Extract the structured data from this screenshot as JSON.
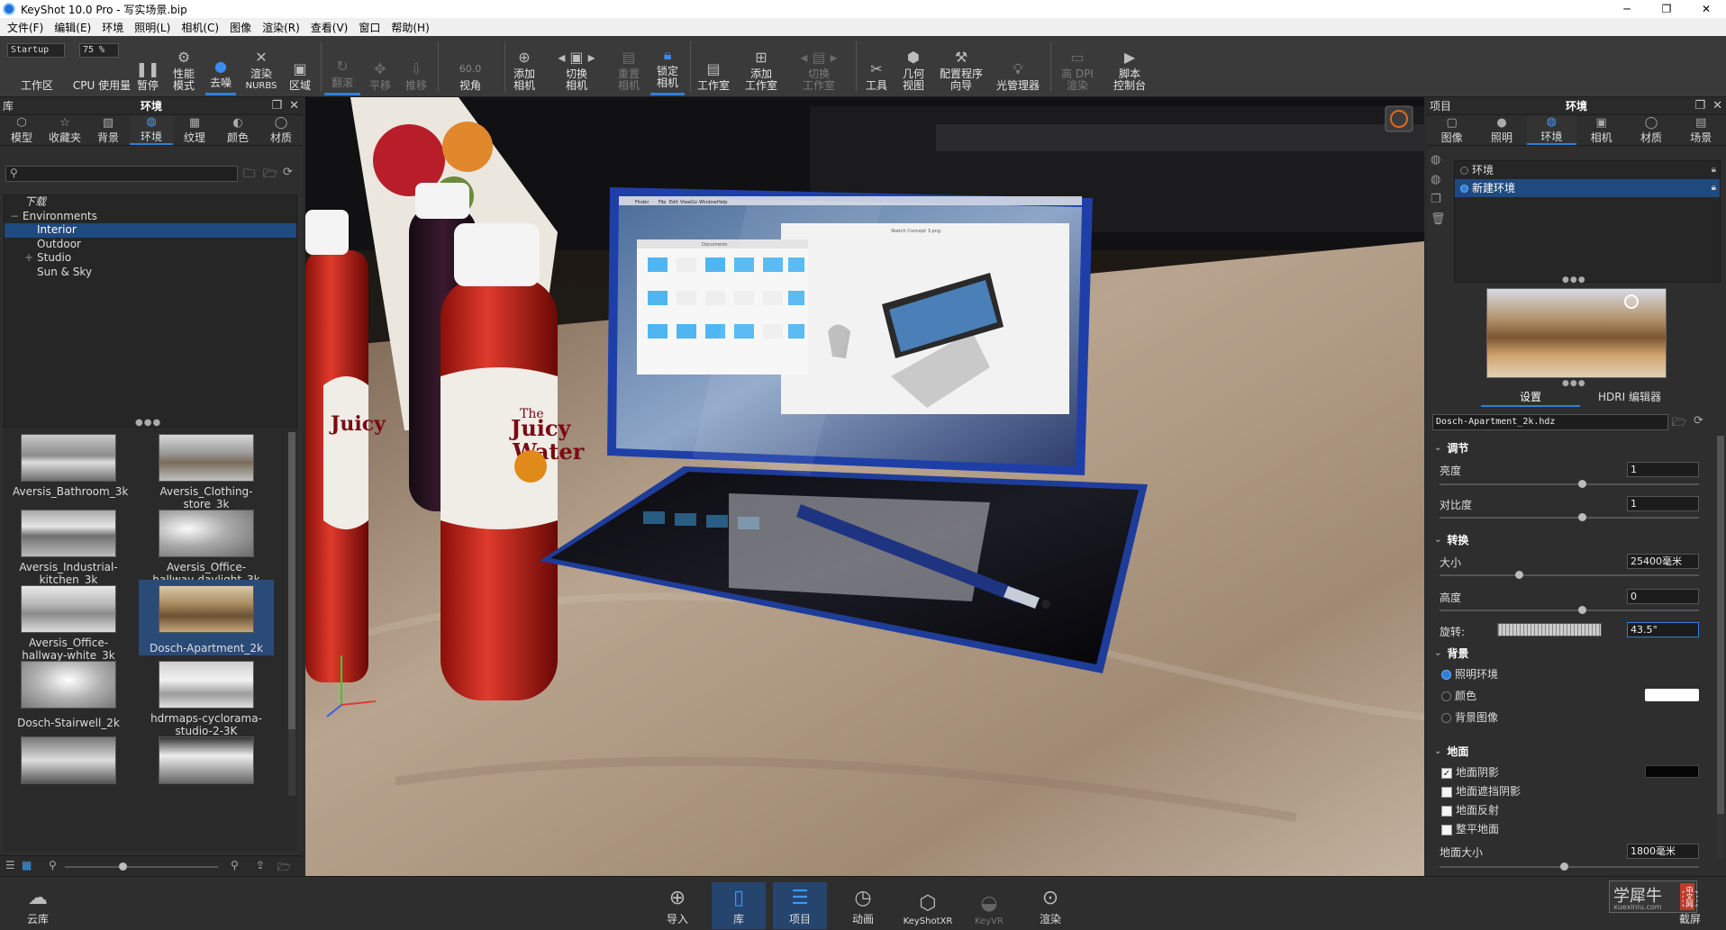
{
  "titlebar": {
    "title": "KeyShot 10.0 Pro  - 写实场景.bip",
    "minimize": "─",
    "maximize": "❐",
    "close": "✕"
  },
  "menu": [
    "文件(F)",
    "编辑(E)",
    "环境",
    "照明(L)",
    "相机(C)",
    "图像",
    "渲染(R)",
    "查看(V)",
    "窗口",
    "帮助(H)"
  ],
  "toolbar": {
    "workspace_value": "Startup",
    "workspace_label": "工作区",
    "cpu_value": "75 %",
    "cpu_label": "CPU 使用量",
    "pause_label": "暂停",
    "perf_label_1": "性能",
    "perf_label_2": "模式",
    "denoise_label": "去噪",
    "nurbs_label_1": "渲染",
    "nurbs_label_2": "NURBS",
    "region_label": "区域",
    "flip_label": "翻滚",
    "pan_label": "平移",
    "push_label": "推移",
    "fov_value": "60.0",
    "fov_label": "视角",
    "add_camera_1": "添加",
    "add_camera_2": "相机",
    "switch_camera_1": "切换",
    "switch_camera_2": "相机",
    "reset_camera_1": "重置",
    "reset_camera_2": "相机",
    "lock_camera_1": "锁定",
    "lock_camera_2": "相机",
    "studio_label": "工作室",
    "add_studio_1": "添加",
    "add_studio_2": "工作室",
    "switch_studio_1": "切换",
    "switch_studio_2": "工作室",
    "tools_label": "工具",
    "geometry_1": "几何",
    "geometry_2": "视图",
    "config_1": "配置程序",
    "config_2": "向导",
    "light_manager": "光管理器",
    "hidpi_1": "高 DPI",
    "hidpi_2": "渲染",
    "script_1": "脚本",
    "script_2": "控制台"
  },
  "library": {
    "title": "库",
    "panel_title": "环境",
    "tabs": [
      {
        "label": "模型",
        "icon": "model-icon"
      },
      {
        "label": "收藏夹",
        "icon": "star-icon"
      },
      {
        "label": "背景",
        "icon": "background-icon"
      },
      {
        "label": "环境",
        "icon": "globe-icon"
      },
      {
        "label": "纹理",
        "icon": "texture-icon"
      },
      {
        "label": "颜色",
        "icon": "palette-icon"
      },
      {
        "label": "材质",
        "icon": "material-icon"
      }
    ],
    "search_placeholder": "",
    "tree": [
      {
        "label": "下载",
        "indent": 0
      },
      {
        "label": "Environments",
        "indent": 0
      },
      {
        "label": "Interior",
        "indent": 2
      },
      {
        "label": "Outdoor",
        "indent": 2
      },
      {
        "label": "Studio",
        "indent": 2
      },
      {
        "label": "Sun & Sky",
        "indent": 2
      }
    ],
    "thumbnails": [
      {
        "label": "Aversis_Bathroom_3k"
      },
      {
        "label": "Aversis_Clothing-store_3k"
      },
      {
        "label": "Aversis_Industrial-kitchen_3k"
      },
      {
        "label": "Aversis_Office-hallway-daylight_3k"
      },
      {
        "label": "Aversis_Office-hallway-white_3k"
      },
      {
        "label": "Dosch-Apartment_2k"
      },
      {
        "label": "Dosch-Stairwell_2k"
      },
      {
        "label": "hdrmaps-cyclorama-studio-2-3K"
      },
      {
        "label": ""
      },
      {
        "label": ""
      }
    ]
  },
  "viewport": {
    "screen_menu": [
      "Finder",
      "File",
      "Edit",
      "View",
      "Go",
      "Window",
      "Help"
    ],
    "window_title_left": "Documents",
    "window_title_right": "Sketch Concept 3.png",
    "bottle_brand_1": "Juicy",
    "bottle_brand_2": "Water",
    "bottle_small": "The"
  },
  "project": {
    "title": "项目",
    "panel_title": "环境",
    "tabs": [
      {
        "label": "图像",
        "icon": "image-icon"
      },
      {
        "label": "照明",
        "icon": "lightbulb-icon"
      },
      {
        "label": "环境",
        "icon": "globe-icon"
      },
      {
        "label": "相机",
        "icon": "camera-icon"
      },
      {
        "label": "材质",
        "icon": "material-icon"
      },
      {
        "label": "场景",
        "icon": "scene-icon"
      }
    ],
    "env_list": [
      "环境",
      "新建环境"
    ],
    "subtabs": [
      "设置",
      "HDRI 编辑器"
    ],
    "hdr_file": "Dosch-Apartment_2k.hdz",
    "sections": {
      "adjust": "调节",
      "transform": "转换",
      "background": "背景",
      "ground": "地面"
    },
    "brightness_label": "亮度",
    "brightness_value": "1",
    "contrast_label": "对比度",
    "contrast_value": "1",
    "size_label": "大小",
    "size_value": "25400毫米",
    "height_label": "高度",
    "height_value": "0",
    "rotation_label": "旋转:",
    "rotation_value": "43.5°",
    "bg_options": [
      "照明环境",
      "颜色",
      "背景图像"
    ],
    "ground_options": [
      {
        "label": "地面阴影",
        "checked": true
      },
      {
        "label": "地面遮挡阴影",
        "checked": false
      },
      {
        "label": "地面反射",
        "checked": false
      },
      {
        "label": "整平地面",
        "checked": false
      }
    ],
    "ground_size_label": "地面大小",
    "ground_size_value": "1800毫米"
  },
  "bottombar": {
    "cloud": "云库",
    "import": "导入",
    "library": "库",
    "project": "项目",
    "animation": "动画",
    "keyshotxr": "KeyShotXR",
    "keyvr": "KeyVR",
    "render": "渲染",
    "screenshot": "截屏",
    "watermark_main": "学犀牛",
    "watermark_sub": "xuexiniu.com",
    "watermark_badge": "中文网"
  },
  "colors": {
    "accent": "#2f7fd8",
    "selected_row": "#1f4a80",
    "panel_bg": "#2e2e2e",
    "tablet_blue": "#1f3fa8"
  }
}
